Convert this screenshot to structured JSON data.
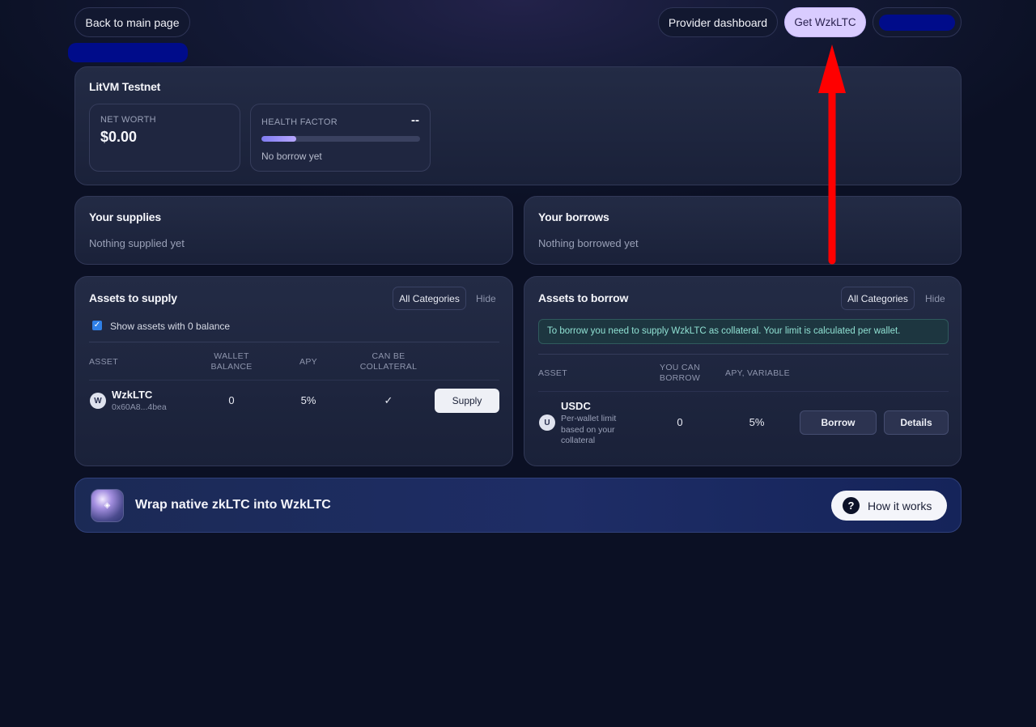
{
  "header": {
    "back_label": "Back to main page",
    "provider_label": "Provider dashboard",
    "get_token_label": "Get WzkLTC"
  },
  "overview": {
    "title": "LitVM Testnet",
    "net_worth_label": "NET WORTH",
    "net_worth_value": "$0.00",
    "health_label": "HEALTH FACTOR",
    "health_value": "--",
    "health_note": "No borrow yet",
    "health_fill": 0.22
  },
  "supplies": {
    "title": "Your supplies",
    "empty": "Nothing supplied yet"
  },
  "borrows": {
    "title": "Your borrows",
    "empty": "Nothing borrowed yet"
  },
  "assets_supply": {
    "title": "Assets to supply",
    "category_label": "All Categories",
    "hide_label": "Hide",
    "checkbox_label": "Show assets with 0 balance",
    "checkbox_checked": true,
    "columns": {
      "asset": "ASSET",
      "wallet_1": "WALLET",
      "wallet_2": "BALANCE",
      "apy": "APY",
      "collat_1": "CAN BE",
      "collat_2": "COLLATERAL"
    },
    "row": {
      "icon_letter": "W",
      "name": "WzkLTC",
      "address": "0x60A8...4bea",
      "balance": "0",
      "apy": "5%",
      "collateral": "✓",
      "action": "Supply"
    }
  },
  "assets_borrow": {
    "title": "Assets to borrow",
    "category_label": "All Categories",
    "hide_label": "Hide",
    "notice": "To borrow you need to supply WzkLTC as collateral. Your limit is calculated per wallet.",
    "columns": {
      "asset": "ASSET",
      "can_1": "YOU CAN",
      "can_2": "BORROW",
      "apy": "APY, VARIABLE"
    },
    "row": {
      "icon_letter": "U",
      "name": "USDC",
      "note_1": "Per-wallet limit",
      "note_2": "based on your",
      "note_3": "collateral",
      "can_borrow": "0",
      "apy": "5%",
      "borrow_label": "Borrow",
      "details_label": "Details"
    }
  },
  "wrap_banner": {
    "title": "Wrap native zkLTC into WzkLTC",
    "how_label": "How it works",
    "help_glyph": "?"
  },
  "colors": {
    "accent_button": "#d9ccff",
    "arrow": "#ff0000",
    "redaction": "#000c8a",
    "notice_text": "#8fe0d2"
  }
}
